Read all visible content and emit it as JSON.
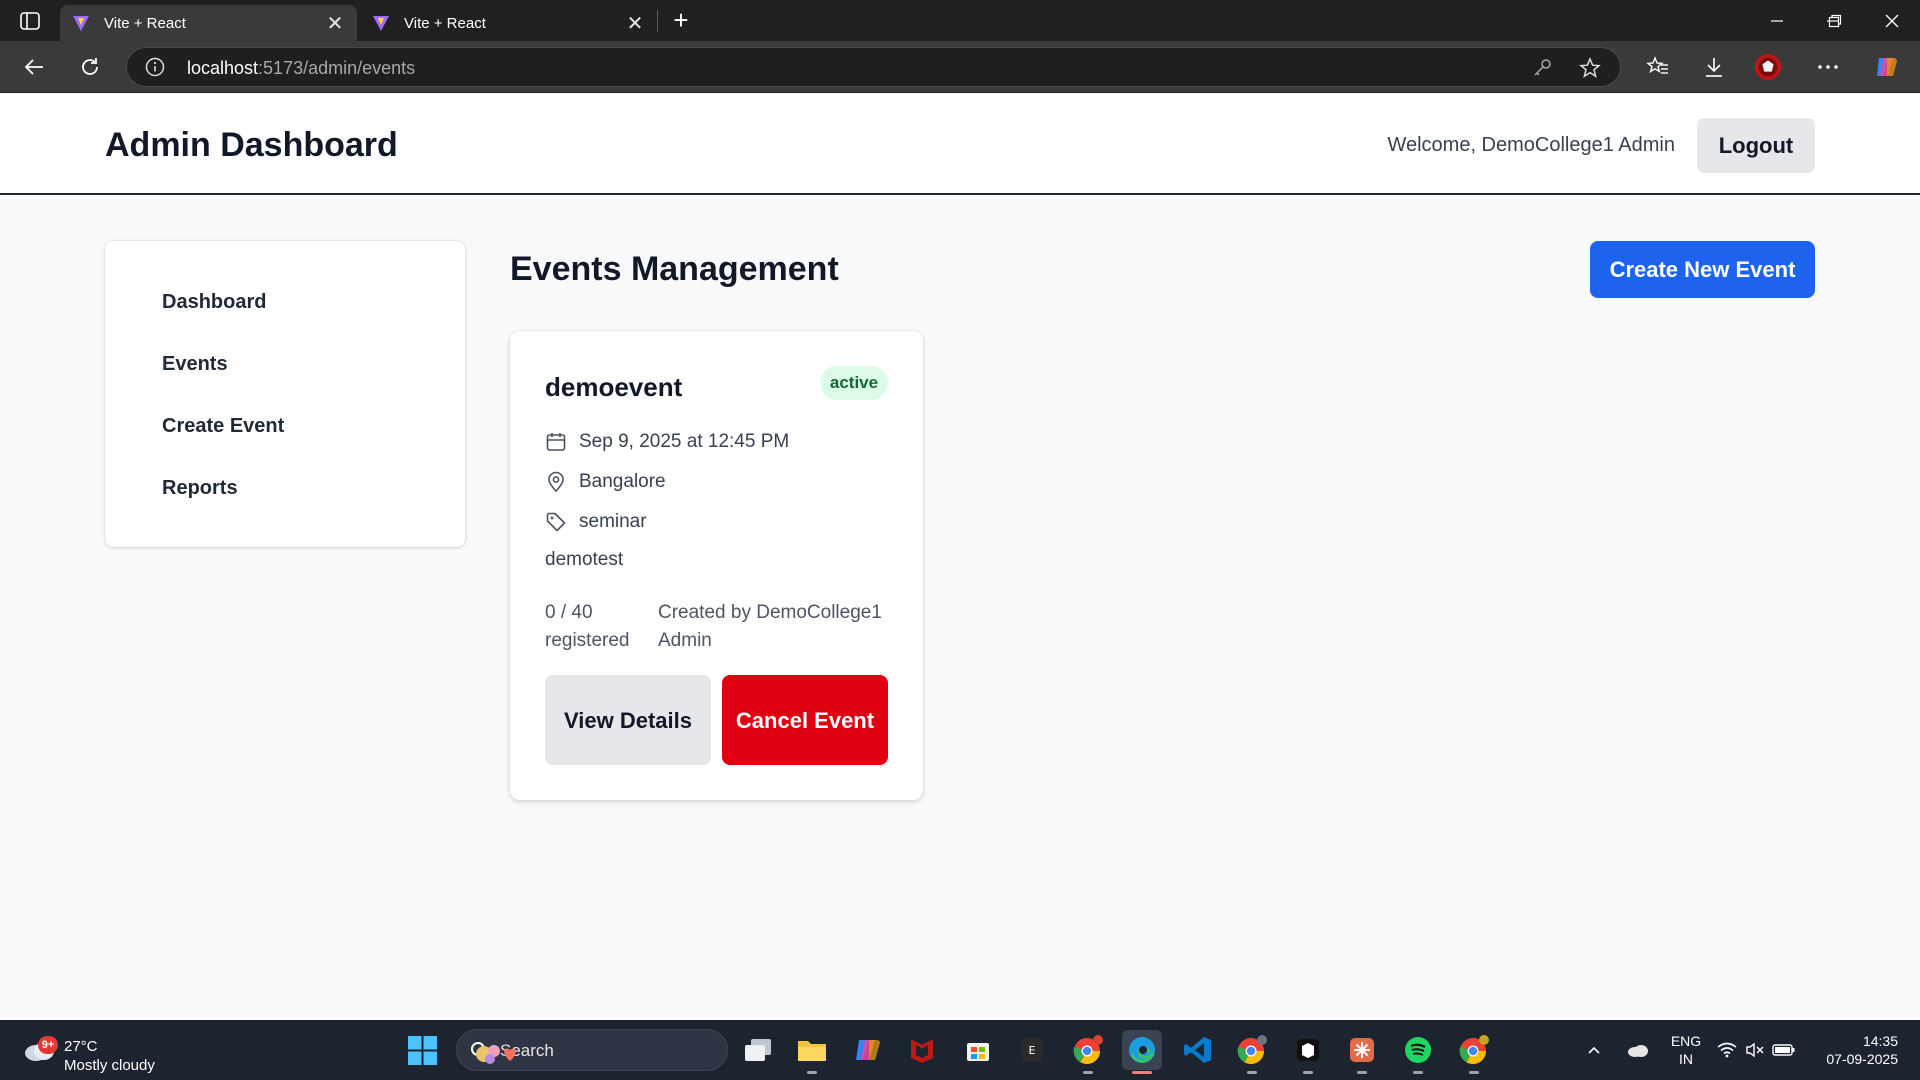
{
  "browser": {
    "tabs": [
      {
        "title": "Vite + React"
      },
      {
        "title": "Vite + React"
      }
    ],
    "url_host": "localhost",
    "url_path": ":5173/admin/events"
  },
  "header": {
    "title": "Admin Dashboard",
    "welcome": "Welcome, DemoCollege1 Admin",
    "logout_label": "Logout"
  },
  "sidebar": {
    "items": [
      {
        "label": "Dashboard"
      },
      {
        "label": "Events"
      },
      {
        "label": "Create Event"
      },
      {
        "label": "Reports"
      }
    ]
  },
  "main": {
    "heading": "Events Management",
    "create_button": "Create New Event",
    "events": [
      {
        "name": "demoevent",
        "status": "active",
        "datetime": "Sep 9, 2025 at 12:45 PM",
        "location": "Bangalore",
        "type": "seminar",
        "description": "demotest",
        "registered": "0 / 40 registered",
        "created_by": "Created by DemoCollege1 Admin",
        "view_label": "View Details",
        "cancel_label": "Cancel Event"
      }
    ]
  },
  "taskbar": {
    "weather_badge": "9+",
    "temperature": "27°C",
    "weather": "Mostly cloudy",
    "search_label": "Search",
    "lang_top": "ENG",
    "lang_bottom": "IN",
    "time": "14:35",
    "date": "07-09-2025"
  },
  "colors": {
    "primary": "#1d63ed",
    "danger": "#e10011",
    "status_active_bg": "#dcfce7",
    "status_active_text": "#166534"
  }
}
